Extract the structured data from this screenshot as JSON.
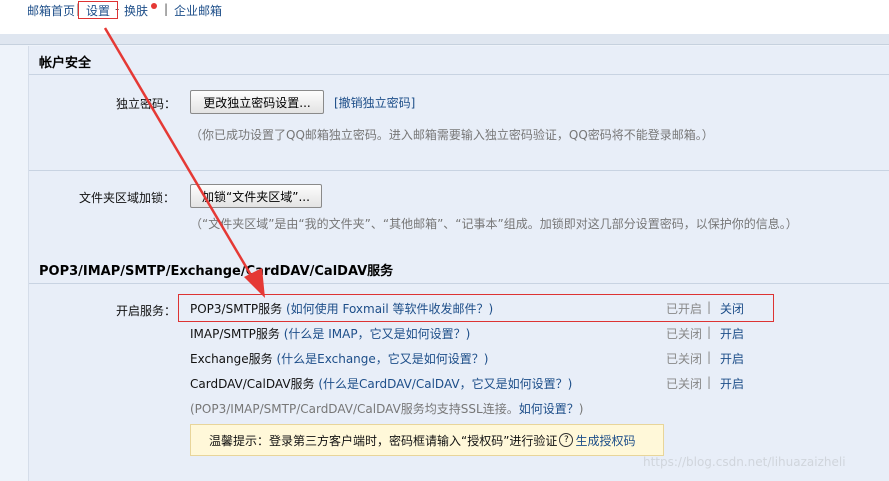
{
  "topnav": {
    "home": "邮箱首页",
    "sep1": "|",
    "settings": "设置",
    "sep2": "-",
    "skin": "换肤",
    "sep3": "|",
    "enterprise": "企业邮箱"
  },
  "account_security": {
    "title": "帐户安全",
    "independent_password": {
      "label": "独立密码：",
      "button": "更改独立密码设置...",
      "link": "[撤销独立密码]",
      "note": "（你已成功设置了QQ邮箱独立密码。进入邮箱需要输入独立密码验证，QQ密码将不能登录邮箱。）"
    },
    "folder_lock": {
      "label": "文件夹区域加锁：",
      "button": "加锁“文件夹区域”...",
      "note": "（“文件夹区域”是由“我的文件夹”、“其他邮箱”、“记事本”组成。加锁即对这几部分设置密码，以保护你的信息。）"
    }
  },
  "pop3": {
    "title": "POP3/IMAP/SMTP/Exchange/CardDAV/CalDAV服务",
    "label": "开启服务：",
    "services": [
      {
        "name": "POP3/SMTP服务",
        "help": "(如何使用 Foxmail 等软件收发邮件？)",
        "status": "已开启",
        "sep": "|",
        "action": "关闭"
      },
      {
        "name": "IMAP/SMTP服务",
        "help": "(什么是 IMAP，它又是如何设置？)",
        "status": "已关闭",
        "sep": "|",
        "action": "开启"
      },
      {
        "name": "Exchange服务",
        "help": "(什么是Exchange，它又是如何设置？)",
        "status": "已关闭",
        "sep": "|",
        "action": "开启"
      },
      {
        "name": "CardDAV/CalDAV服务",
        "help": "(什么是CardDAV/CalDAV，它又是如何设置？)",
        "status": "已关闭",
        "sep": "|",
        "action": "开启"
      }
    ],
    "ssl_note": "(POP3/IMAP/SMTP/CardDAV/CalDAV服务均支持SSL连接。",
    "ssl_link": "如何设置？",
    "ssl_close": ")",
    "tip_prefix": "温馨提示：登录第三方客户端时，密码框请输入“授权码”进行验证",
    "tip_icon": "?",
    "tip_link": "生成授权码"
  },
  "watermark": "https://blog.csdn.net/lihuazaizheli",
  "colors": {
    "link": "#1d4e89",
    "annotation": "#d33",
    "panel_bg": "#e8eef8",
    "tip_bg": "#fff8d9"
  }
}
